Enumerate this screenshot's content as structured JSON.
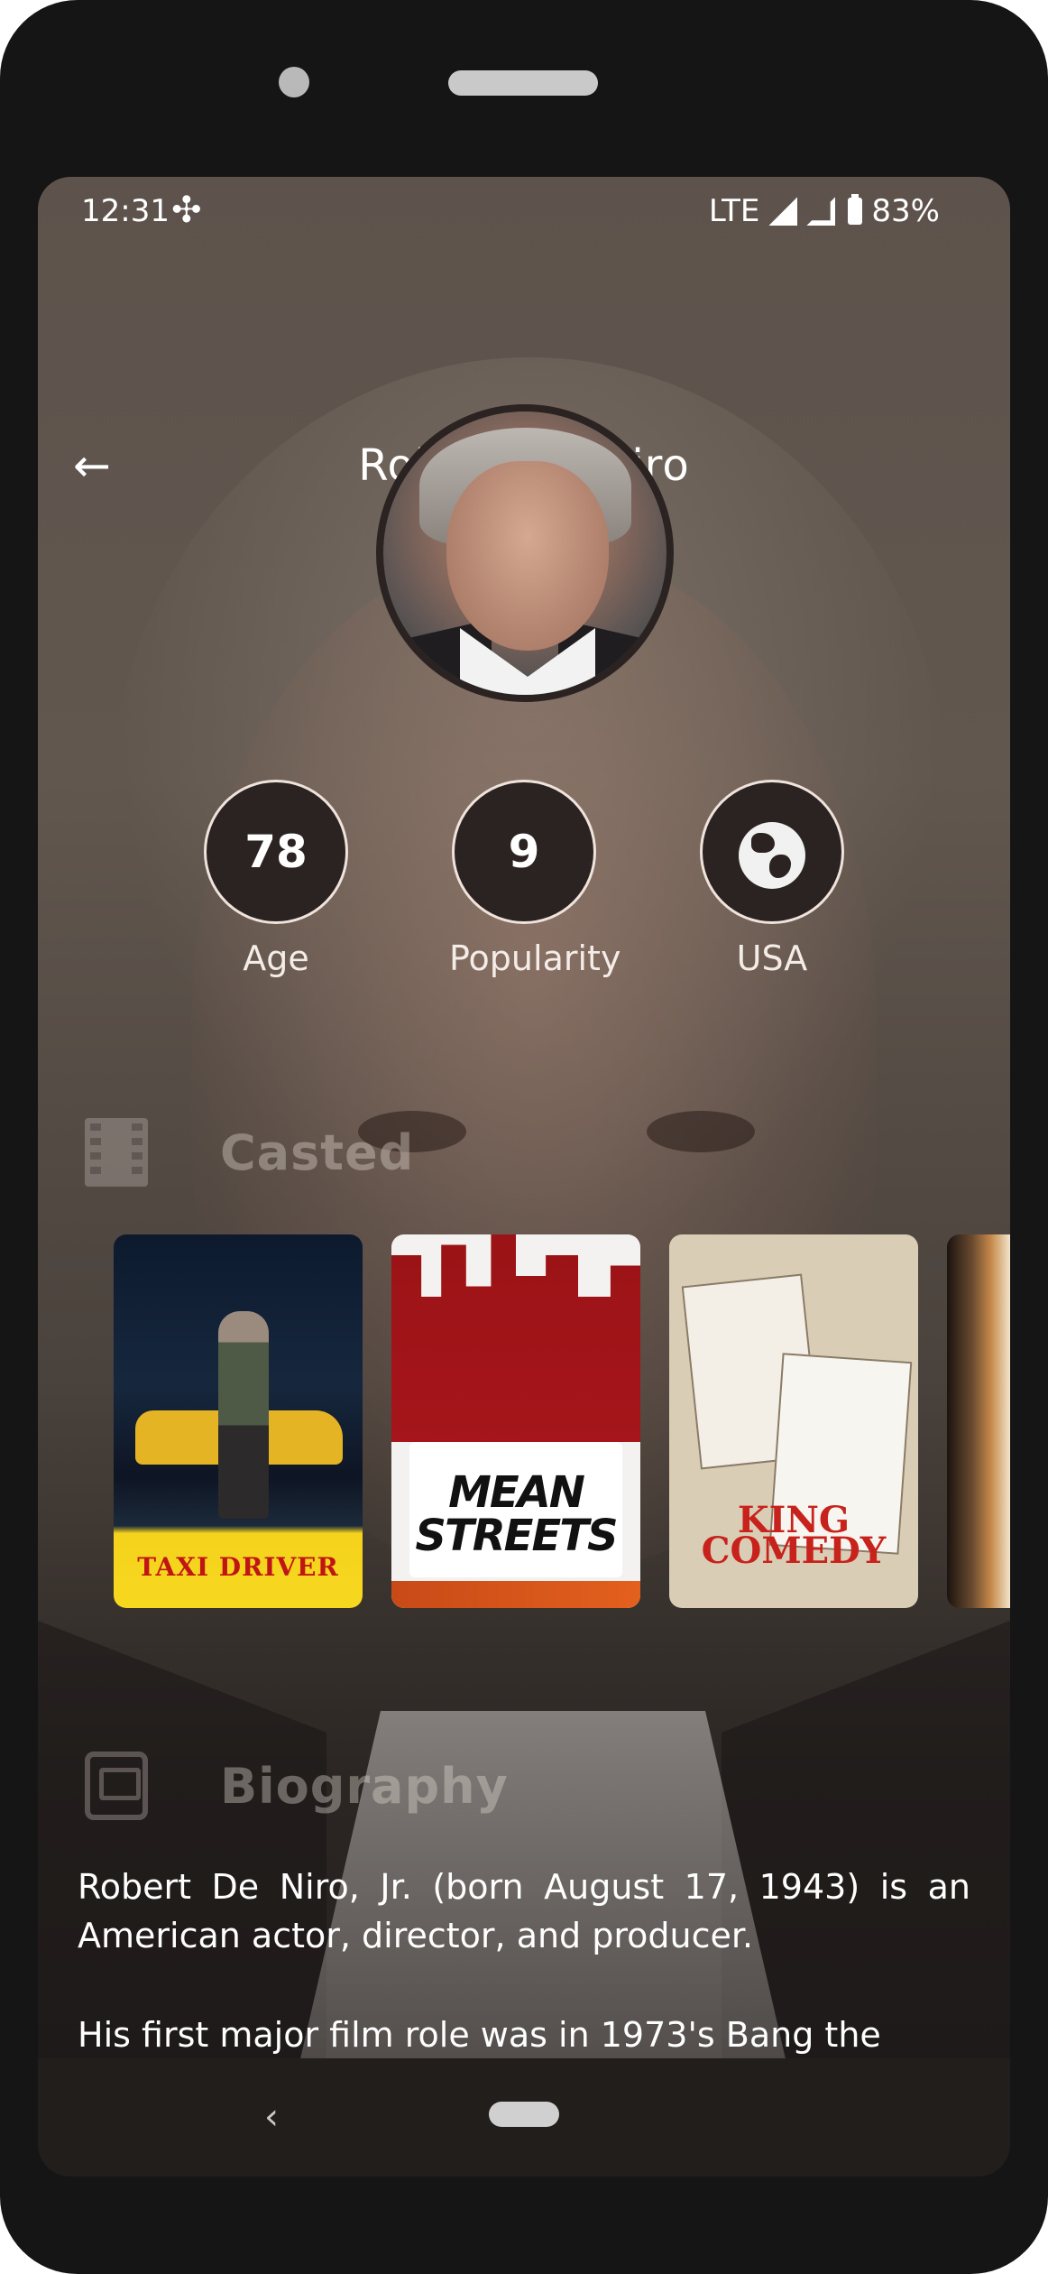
{
  "status_bar": {
    "time": "12:31",
    "network": "LTE",
    "battery": "83%"
  },
  "header": {
    "title": "Robert De Niro",
    "back_icon": "arrow-left-icon"
  },
  "stats": {
    "age_value": "78",
    "age_label": "Age",
    "popularity_value": "9",
    "popularity_label": "Popularity",
    "country_icon": "globe-icon",
    "country_label": "USA"
  },
  "sections": {
    "casted_label": "Casted",
    "casted_icon": "film-icon",
    "biography_label": "Biography",
    "biography_icon": "biography-icon"
  },
  "casted": [
    {
      "title": "TAXI DRIVER"
    },
    {
      "title": "MEAN STREETS"
    },
    {
      "title": "KING COMEDY"
    }
  ],
  "biography": {
    "paragraph_1": "Robert De Niro, Jr. (born August 17, 1943) is an American actor, director, and producer.",
    "paragraph_2": "His first major film role was in 1973's Bang the"
  },
  "colors": {
    "stat_circle_bg": "#2b2322",
    "stat_circle_border": "#efe3dc",
    "text_primary": "#ffffff",
    "section_header_text": "#e6dcd6"
  }
}
